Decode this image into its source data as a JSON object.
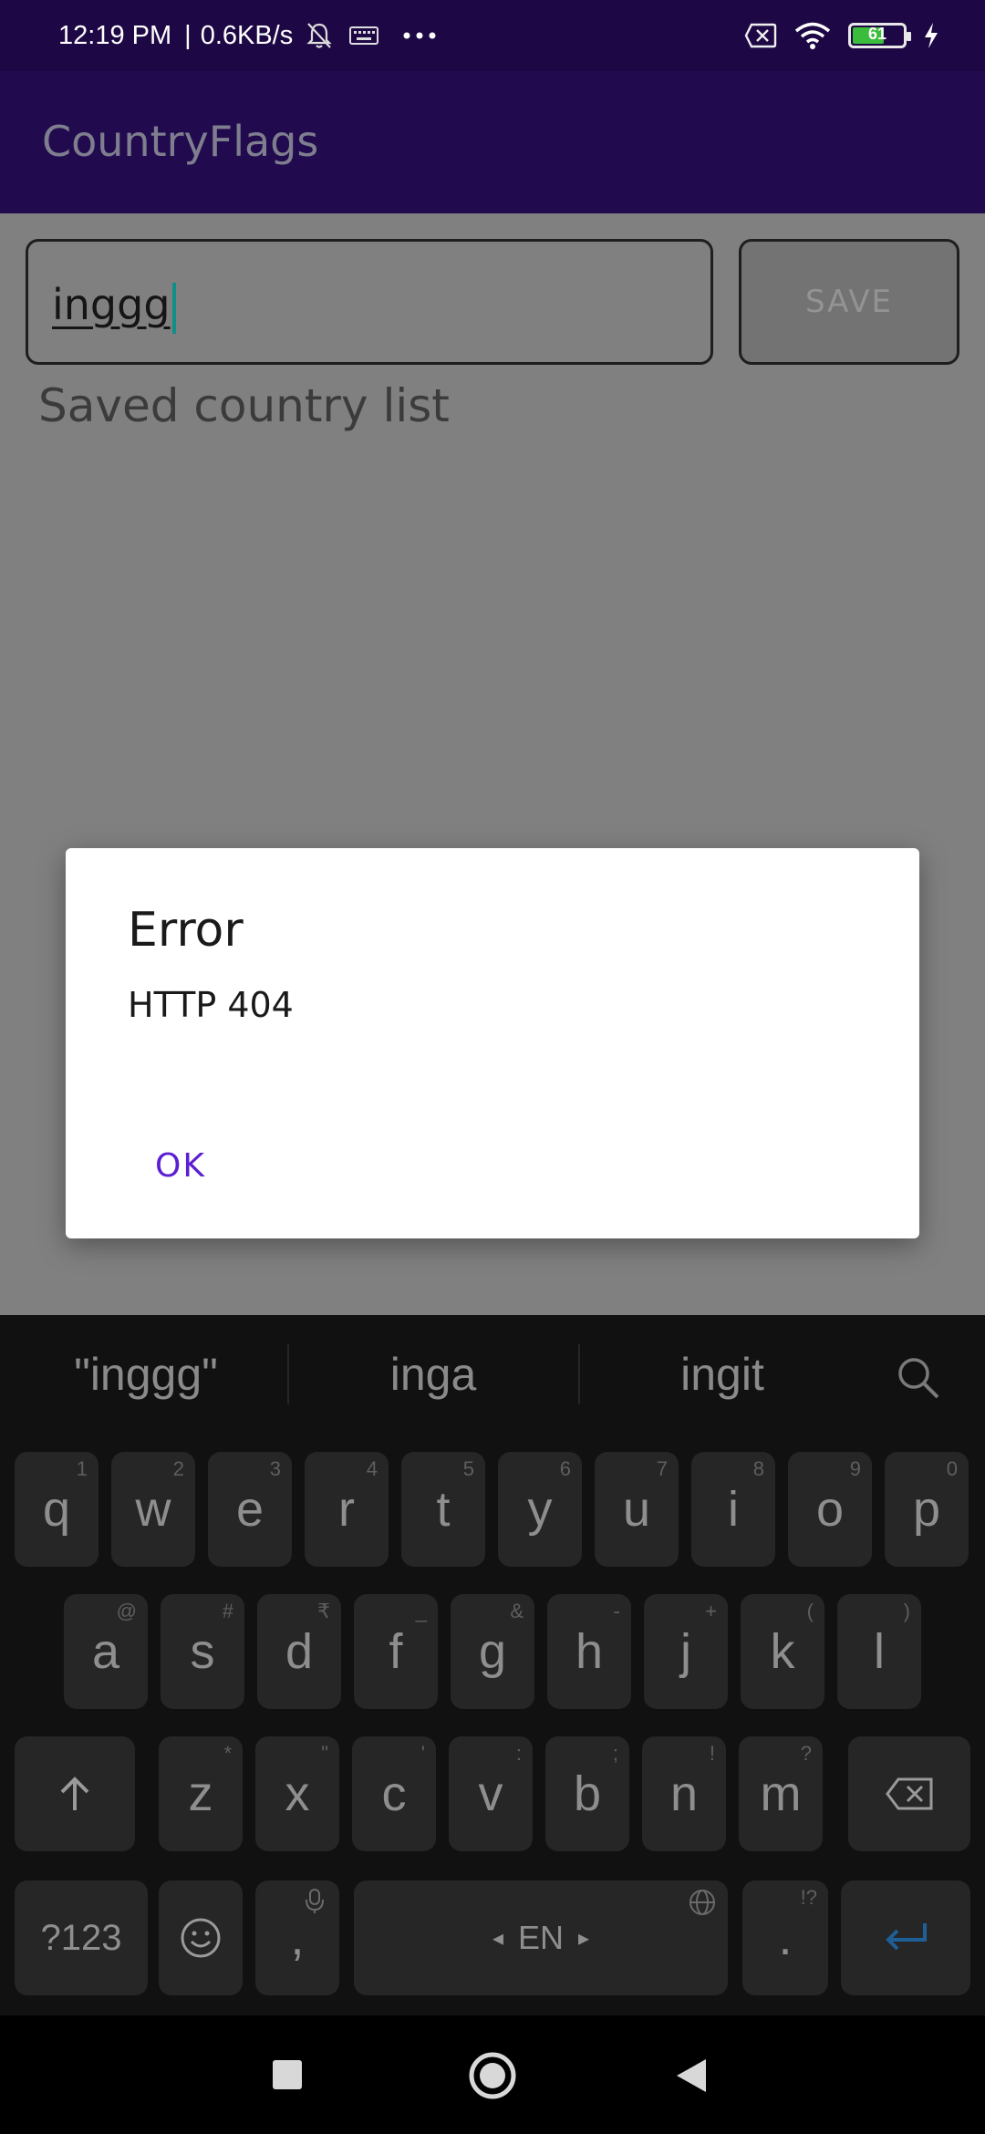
{
  "status_bar": {
    "time": "12:19 PM",
    "net_speed": "0.6KB/s",
    "battery_level": "61",
    "battery_fraction": 0.61
  },
  "app_bar": {
    "title": "CountryFlags"
  },
  "form": {
    "input_value": "inggg",
    "save_label": "SAVE"
  },
  "list_heading": "Saved country list",
  "dialog": {
    "title": "Error",
    "message": "HTTP 404",
    "ok_label": "OK"
  },
  "keyboard": {
    "suggestions": [
      "\"inggg\"",
      "inga",
      "ingit"
    ],
    "row1": [
      {
        "k": "q",
        "h": "1"
      },
      {
        "k": "w",
        "h": "2"
      },
      {
        "k": "e",
        "h": "3"
      },
      {
        "k": "r",
        "h": "4"
      },
      {
        "k": "t",
        "h": "5"
      },
      {
        "k": "y",
        "h": "6"
      },
      {
        "k": "u",
        "h": "7"
      },
      {
        "k": "i",
        "h": "8"
      },
      {
        "k": "o",
        "h": "9"
      },
      {
        "k": "p",
        "h": "0"
      }
    ],
    "row2": [
      {
        "k": "a",
        "h": "@"
      },
      {
        "k": "s",
        "h": "#"
      },
      {
        "k": "d",
        "h": "₹"
      },
      {
        "k": "f",
        "h": "_"
      },
      {
        "k": "g",
        "h": "&"
      },
      {
        "k": "h",
        "h": "-"
      },
      {
        "k": "j",
        "h": "+"
      },
      {
        "k": "k",
        "h": "("
      },
      {
        "k": "l",
        "h": ")"
      }
    ],
    "row3": [
      {
        "k": "z",
        "h": "*"
      },
      {
        "k": "x",
        "h": "\""
      },
      {
        "k": "c",
        "h": "'"
      },
      {
        "k": "v",
        "h": ":"
      },
      {
        "k": "b",
        "h": ";"
      },
      {
        "k": "n",
        "h": "!"
      },
      {
        "k": "m",
        "h": "?"
      }
    ],
    "symbols_label": "?123",
    "comma_label": ",",
    "space_label": "EN",
    "period_label": ".",
    "period_hint": "!?"
  },
  "icons": {
    "mute": "bell-off-icon",
    "keyboard": "keyboard-icon",
    "more": "more-dots-icon",
    "sim": "sim-x-icon",
    "wifi": "wifi-icon",
    "charging": "bolt-icon",
    "search": "search-icon",
    "shift": "shift-arrow-icon",
    "backspace": "backspace-icon",
    "emoji": "emoji-icon",
    "mic": "mic-icon",
    "globe": "globe-icon",
    "enter": "enter-icon",
    "recents": "square-icon",
    "home": "circle-icon",
    "back": "triangle-icon"
  },
  "colors": {
    "app_bar": "#220a4f",
    "status_bar": "#1d0845",
    "accent": "#5b1fd1",
    "cursor": "#0f8f86",
    "battery": "#3cbc3c",
    "enter": "#1f5f97"
  }
}
